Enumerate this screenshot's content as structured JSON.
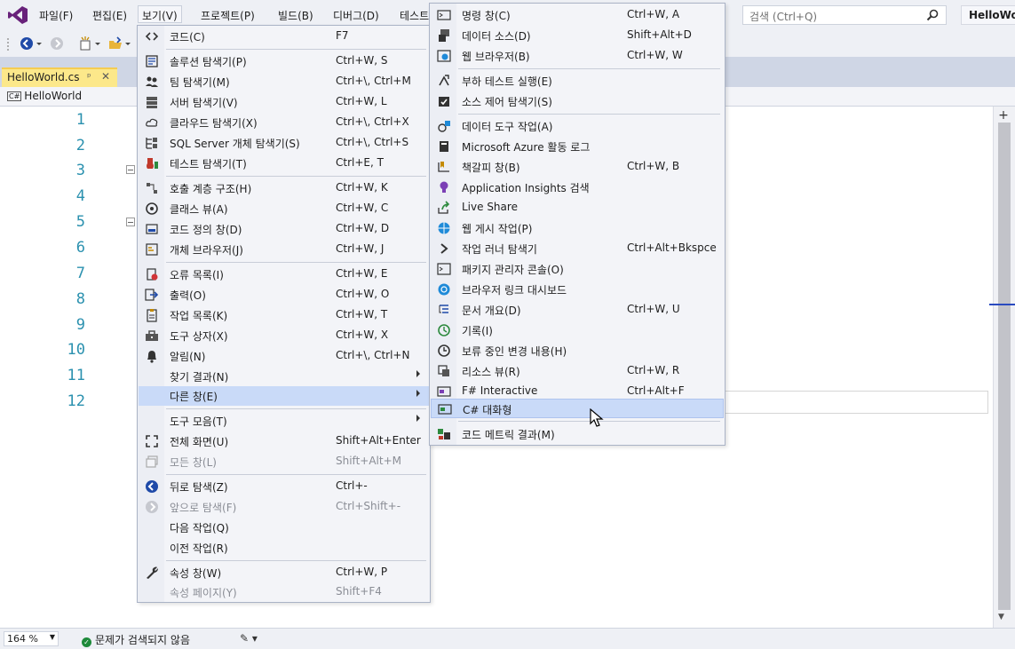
{
  "menubar": {
    "items": [
      "파일(F)",
      "편집(E)",
      "보기(V)",
      "프로젝트(P)",
      "빌드(B)",
      "디버그(D)",
      "테스트"
    ],
    "search_placeholder": "검색 (Ctrl+Q)",
    "solution_name": "HelloWo"
  },
  "document_tab": {
    "title": "HelloWorld.cs",
    "pin_glyph": "ᵖ",
    "close_glyph": "✕"
  },
  "navbar": {
    "scope": "HelloWorld",
    "badge": "C#"
  },
  "editor": {
    "line_numbers": [
      "1",
      "2",
      "3",
      "4",
      "5",
      "6",
      "7",
      "8",
      "9",
      "10",
      "11",
      "12"
    ]
  },
  "status": {
    "zoom": "164 %",
    "message": "문제가 검색되지 않음"
  },
  "view_menu": {
    "items": [
      {
        "label": "코드(C)",
        "shortcut": "F7",
        "icon": "code-icon"
      },
      {
        "label": "솔루션 탐색기(P)",
        "shortcut": "Ctrl+W, S",
        "icon": "solution-explorer-icon"
      },
      {
        "label": "팀 탐색기(M)",
        "shortcut": "Ctrl+\\, Ctrl+M",
        "icon": "team-explorer-icon"
      },
      {
        "label": "서버 탐색기(V)",
        "shortcut": "Ctrl+W, L",
        "icon": "server-explorer-icon"
      },
      {
        "label": "클라우드 탐색기(X)",
        "shortcut": "Ctrl+\\, Ctrl+X",
        "icon": "cloud-explorer-icon"
      },
      {
        "label": "SQL Server 개체 탐색기(S)",
        "shortcut": "Ctrl+\\, Ctrl+S",
        "icon": "sql-server-icon"
      },
      {
        "label": "테스트 탐색기(T)",
        "shortcut": "Ctrl+E, T",
        "icon": "test-explorer-icon"
      },
      {
        "label": "호출 계층 구조(H)",
        "shortcut": "Ctrl+W, K",
        "icon": "call-hierarchy-icon"
      },
      {
        "label": "클래스 뷰(A)",
        "shortcut": "Ctrl+W, C",
        "icon": "class-view-icon"
      },
      {
        "label": "코드 정의 창(D)",
        "shortcut": "Ctrl+W, D",
        "icon": "code-definition-icon"
      },
      {
        "label": "개체 브라우저(J)",
        "shortcut": "Ctrl+W, J",
        "icon": "object-browser-icon"
      },
      {
        "label": "오류 목록(I)",
        "shortcut": "Ctrl+W, E",
        "icon": "error-list-icon"
      },
      {
        "label": "출력(O)",
        "shortcut": "Ctrl+W, O",
        "icon": "output-icon"
      },
      {
        "label": "작업 목록(K)",
        "shortcut": "Ctrl+W, T",
        "icon": "task-list-icon"
      },
      {
        "label": "도구 상자(X)",
        "shortcut": "Ctrl+W, X",
        "icon": "toolbox-icon"
      },
      {
        "label": "알림(N)",
        "shortcut": "Ctrl+\\, Ctrl+N",
        "icon": "notifications-icon"
      },
      {
        "label": "찾기 결과(N)",
        "shortcut": "",
        "icon": ""
      },
      {
        "label": "다른 창(E)",
        "shortcut": "",
        "icon": ""
      },
      {
        "label": "도구 모음(T)",
        "shortcut": "",
        "icon": ""
      },
      {
        "label": "전체 화면(U)",
        "shortcut": "Shift+Alt+Enter",
        "icon": "full-screen-icon"
      },
      {
        "label": "모든 창(L)",
        "shortcut": "Shift+Alt+M",
        "icon": "all-windows-icon"
      },
      {
        "label": "뒤로 탐색(Z)",
        "shortcut": "Ctrl+-",
        "icon": "navigate-back-icon"
      },
      {
        "label": "앞으로 탐색(F)",
        "shortcut": "Ctrl+Shift+-",
        "icon": "navigate-forward-icon"
      },
      {
        "label": "다음 작업(Q)",
        "shortcut": "",
        "icon": ""
      },
      {
        "label": "이전 작업(R)",
        "shortcut": "",
        "icon": ""
      },
      {
        "label": "속성 창(W)",
        "shortcut": "Ctrl+W, P",
        "icon": "wrench-icon"
      },
      {
        "label": "속성 페이지(Y)",
        "shortcut": "Shift+F4",
        "icon": ""
      }
    ]
  },
  "other_windows_menu": {
    "items": [
      {
        "label": "명령 창(C)",
        "shortcut": "Ctrl+W, A",
        "icon": "command-window-icon"
      },
      {
        "label": "데이터 소스(D)",
        "shortcut": "Shift+Alt+D",
        "icon": "data-sources-icon"
      },
      {
        "label": "웹 브라우저(B)",
        "shortcut": "Ctrl+W, W",
        "icon": "web-browser-icon"
      },
      {
        "label": "부하 테스트 실행(E)",
        "shortcut": "",
        "icon": "load-test-icon"
      },
      {
        "label": "소스 제어 탐색기(S)",
        "shortcut": "",
        "icon": "source-control-icon"
      },
      {
        "label": "데이터 도구 작업(A)",
        "shortcut": "",
        "icon": "data-tools-icon"
      },
      {
        "label": "Microsoft Azure 활동 로그",
        "shortcut": "",
        "icon": "azure-log-icon"
      },
      {
        "label": "책갈피 창(B)",
        "shortcut": "Ctrl+W, B",
        "icon": "bookmark-icon"
      },
      {
        "label": "Application Insights 검색",
        "shortcut": "",
        "icon": "insights-bulb-icon"
      },
      {
        "label": "Live Share",
        "shortcut": "",
        "icon": "live-share-icon"
      },
      {
        "label": "웹 게시 작업(P)",
        "shortcut": "",
        "icon": "web-publish-icon"
      },
      {
        "label": "작업 러너 탐색기",
        "shortcut": "Ctrl+Alt+Bkspce",
        "icon": "chevron-right-icon"
      },
      {
        "label": "패키지 관리자 콘솔(O)",
        "shortcut": "",
        "icon": "package-console-icon"
      },
      {
        "label": "브라우저 링크 대시보드",
        "shortcut": "",
        "icon": "browser-link-icon"
      },
      {
        "label": "문서 개요(D)",
        "shortcut": "Ctrl+W, U",
        "icon": "document-outline-icon"
      },
      {
        "label": "기록(I)",
        "shortcut": "",
        "icon": "history-icon"
      },
      {
        "label": "보류 중인 변경 내용(H)",
        "shortcut": "",
        "icon": "pending-changes-icon"
      },
      {
        "label": "리소스 뷰(R)",
        "shortcut": "Ctrl+W, R",
        "icon": "resource-view-icon"
      },
      {
        "label": "F# Interactive",
        "shortcut": "Ctrl+Alt+F",
        "icon": "fsharp-interactive-icon"
      },
      {
        "label": "C# 대화형",
        "shortcut": "",
        "icon": "csharp-interactive-icon"
      },
      {
        "label": "코드 메트릭 결과(M)",
        "shortcut": "",
        "icon": "code-metrics-icon"
      }
    ]
  },
  "colors": {
    "accent": "#68217a",
    "selection": "#c9daf8",
    "tab": "#fce88a",
    "line_number": "#2b91af"
  }
}
